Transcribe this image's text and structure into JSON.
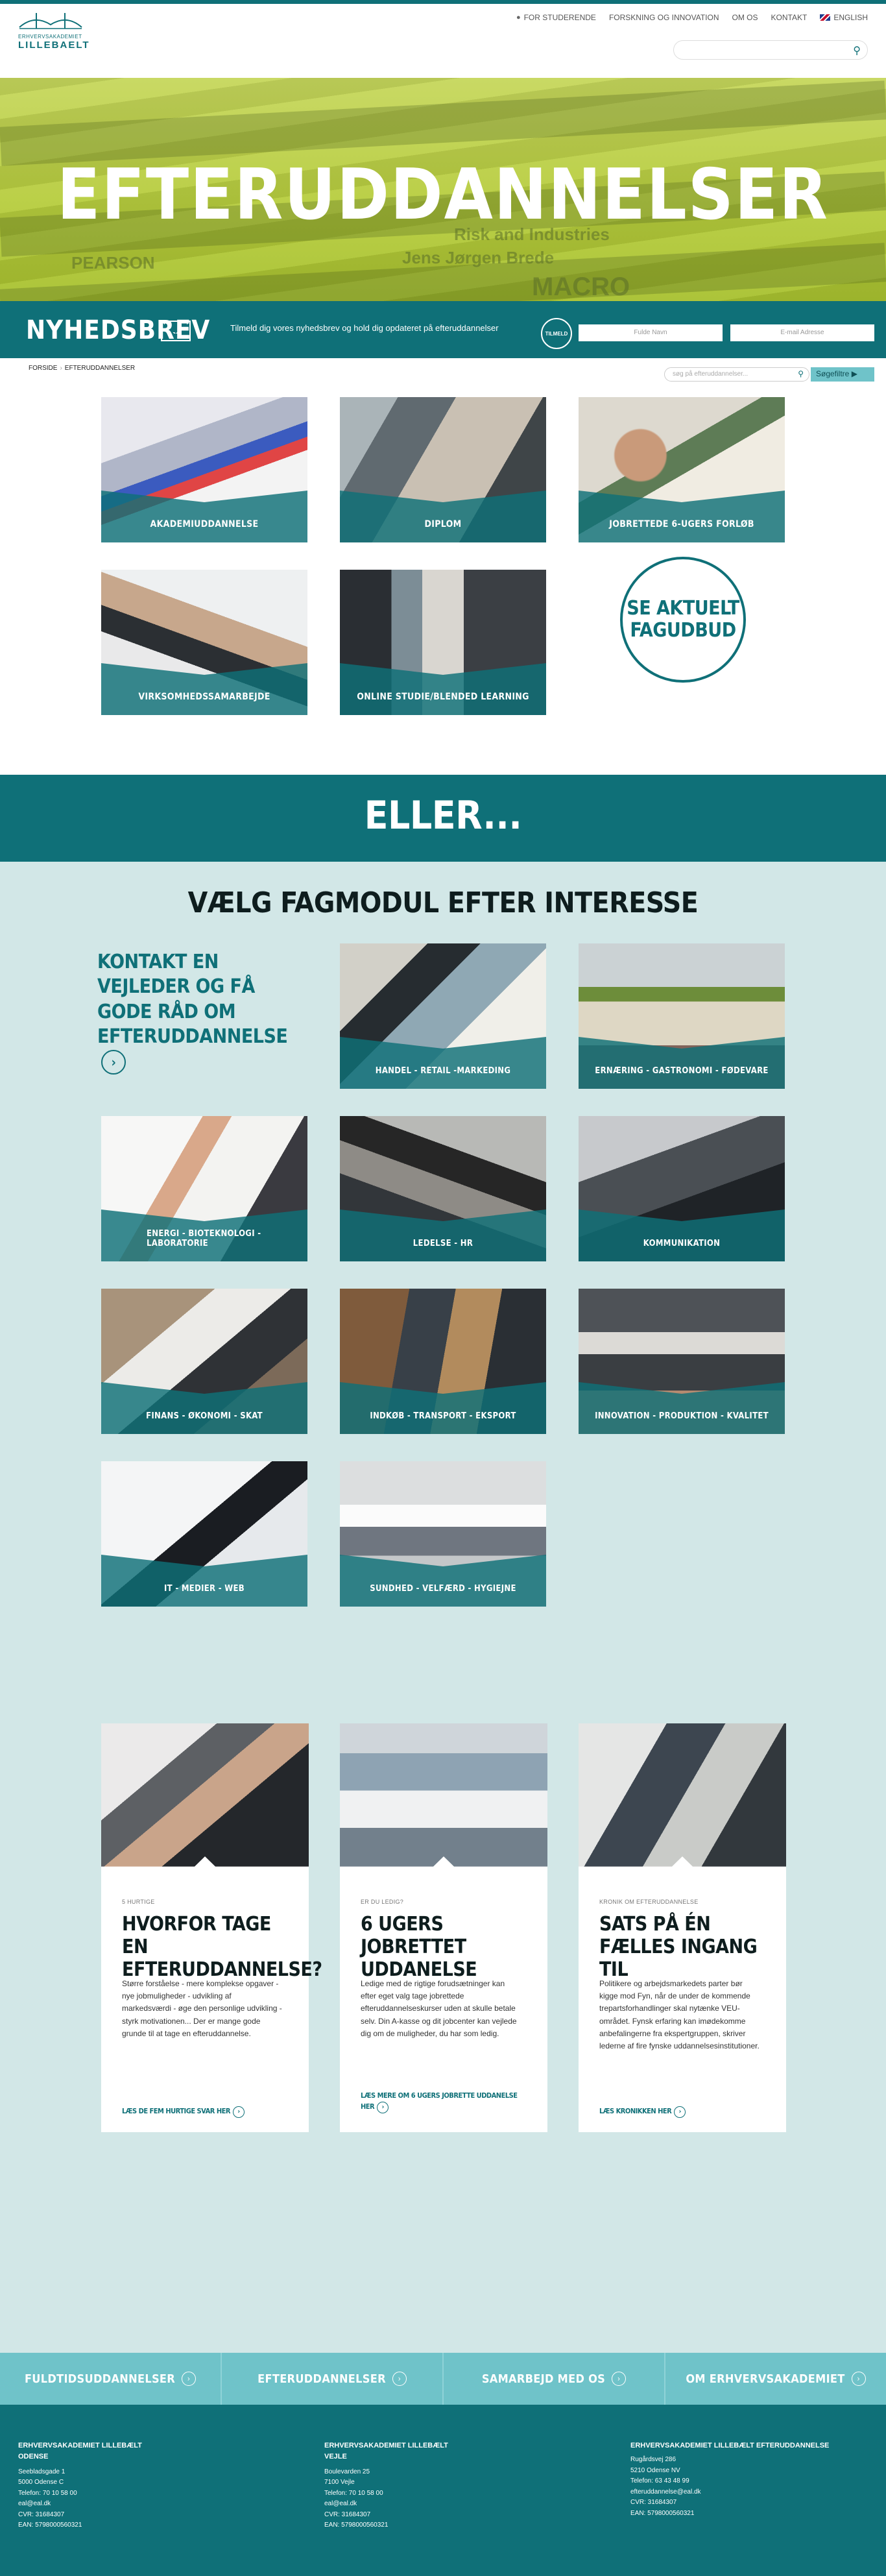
{
  "header": {
    "logo_subtitle": "ERHVERVSAKADEMIET",
    "logo_name": "LILLEBAELT",
    "nav": [
      {
        "label": "FOR STUDERENDE",
        "icon": "person-icon"
      },
      {
        "label": "FORSKNING OG INNOVATION"
      },
      {
        "label": "OM OS"
      },
      {
        "label": "KONTAKT"
      },
      {
        "label": "ENGLISH",
        "icon": "uk-flag-icon"
      }
    ],
    "search_placeholder": ""
  },
  "hero": {
    "title": "EFTERUDDANNELSER",
    "background_texts": [
      "Risk and Industries",
      "Jens Jørgen Brede",
      "PEARSON",
      "MACRO"
    ]
  },
  "newsletter": {
    "title": "NYHEDSBREV",
    "text": "Tilmeld dig vores nyhedsbrev og hold dig opdateret på efteruddannelser",
    "signup_label": "TILMELD",
    "name_placeholder": "Fulde Navn",
    "email_placeholder": "E-mail Adresse"
  },
  "breadcrumb": {
    "items": [
      "FORSIDE",
      "EFTERUDDANNELSER"
    ],
    "filter_placeholder": "søg på efteruddannelser...",
    "filter_button": "Søgefiltre"
  },
  "programs": [
    {
      "label": "AKADEMIUDDANNELSE"
    },
    {
      "label": "DIPLOM"
    },
    {
      "label": "JOBRETTEDE 6-UGERS FORLØB"
    },
    {
      "label": "VIRKSOMHEDSSAMARBEJDE"
    },
    {
      "label": "ONLINE STUDIE/BLENDED LEARNING"
    }
  ],
  "aktuelt": {
    "label": "SE AKTUELT FAGUDBUD"
  },
  "eller": {
    "label": "ELLER..."
  },
  "interest": {
    "title": "VÆLG FAGMODUL EFTER INTERESSE",
    "contact": "KONTAKT EN VEJLEDER OG FÅ GODE RÅD OM EFTERUDDANNELSE",
    "contact_arrow": "›",
    "modules": [
      {
        "label": "HANDEL - RETAIL -MARKEDING"
      },
      {
        "label": "ERNÆRING - GASTRONOMI - FØDEVARE"
      },
      {
        "label": "ENERGI - BIOTEKNOLOGI - LABORATORIE"
      },
      {
        "label": "LEDELSE - HR"
      },
      {
        "label": "KOMMUNIKATION"
      },
      {
        "label": "FINANS - ØKONOMI - SKAT"
      },
      {
        "label": "INDKØB - TRANSPORT - EKSPORT"
      },
      {
        "label": "INNOVATION - PRODUKTION - KVALITET"
      },
      {
        "label": "IT - MEDIER - WEB"
      },
      {
        "label": "SUNDHED - VELFÆRD - HYGIEJNE"
      }
    ]
  },
  "articles": [
    {
      "kicker": "5 HURTIGE",
      "title": "HVORFOR TAGE EN EFTERUDDANNELSE?",
      "body": "Større forståelse - mere komplekse opgaver - nye jobmuligheder - udvikling af markedsværdi - øge den personlige udvikling - styrk motivationen... Der er mange gode grunde til at tage en efteruddannelse.",
      "link": "LÆS DE FEM HURTIGE SVAR HER"
    },
    {
      "kicker": "ER DU LEDIG?",
      "title": "6 UGERS JOBRETTET UDDANELSE",
      "body": "Ledige med de rigtige forudsætninger kan efter eget valg tage jobrettede efteruddannelseskurser uden at skulle betale selv. Din A-kasse og dit jobcenter kan vejlede dig om de muligheder, du har som ledig.",
      "link": "LÆS MERE OM 6 UGERS JOBRETTE UDDANELSE HER"
    },
    {
      "kicker": "KRONIK OM EFTERUDDANNELSE",
      "title": "SATS PÅ ÉN FÆLLES INGANG TIL",
      "body": "Politikere og arbejdsmarkedets parter bør kigge mod Fyn, når de under de kommende trepartsforhandlinger skal nytænke VEU-området. Fynsk erfaring kan imødekomme anbefalingerne fra ekspertgruppen, skriver lederne af fire fynske uddannelsesinstitutioner.",
      "link": "LÆS KRONIKKEN HER"
    }
  ],
  "bottomnav": [
    {
      "label": "FULDTIDSUDDANNELSER"
    },
    {
      "label": "EFTERUDDANNELSER"
    },
    {
      "label": "SAMARBEJD MED OS"
    },
    {
      "label": "OM ERHVERVSAKADEMIET"
    }
  ],
  "footer": [
    {
      "name": "ERHVERVSAKADEMIET LILLEBÆLT",
      "city": "ODENSE",
      "lines": [
        "Seebladsgade 1",
        "5000 Odense C",
        "Telefon: 70 10 58 00",
        "eal@eal.dk",
        "CVR: 31684307",
        "EAN: 5798000560321"
      ]
    },
    {
      "name": "ERHVERVSAKADEMIET LILLEBÆLT",
      "city": "VEJLE",
      "lines": [
        "Boulevarden 25",
        "7100 Vejle",
        "Telefon: 70 10 58 00",
        "eal@eal.dk",
        "CVR: 31684307",
        "EAN: 5798000560321"
      ]
    },
    {
      "name": "ERHVERVSAKADEMIET LILLEBÆLT EFTERUDDANNELSE",
      "city": "",
      "lines": [
        "Rugårdsvej 286",
        "5210 Odense NV",
        "Telefon: 63 43 48 99",
        "efteruddannelse@eal.dk",
        "CVR: 31684307",
        "EAN: 5798000560321"
      ]
    }
  ],
  "colors": {
    "primary": "#0f7078",
    "accent": "#6fc3c9",
    "section_bg": "#d2e7e7",
    "hero": "#b7cd3e"
  }
}
